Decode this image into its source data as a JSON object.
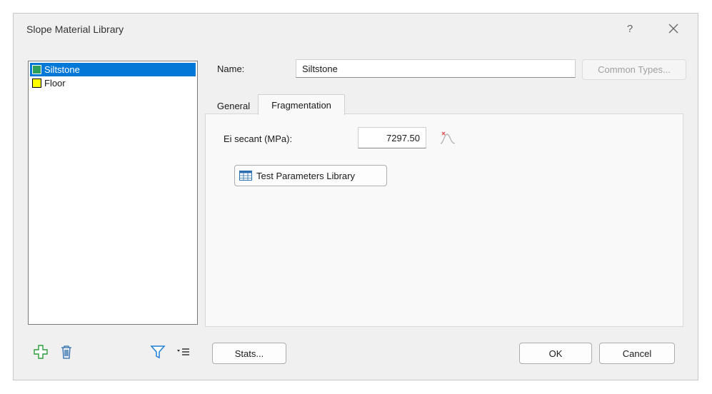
{
  "window": {
    "title": "Slope Material Library",
    "help_glyph": "?"
  },
  "materials": [
    {
      "name": "Siltstone",
      "color": "#2e9e5b",
      "selected": true
    },
    {
      "name": "Floor",
      "color": "#ffff00",
      "selected": false
    }
  ],
  "name_field": {
    "label": "Name:",
    "value": "Siltstone"
  },
  "common_types_label": "Common Types...",
  "tabs": [
    {
      "label": "General",
      "active": false
    },
    {
      "label": "Fragmentation",
      "active": true
    }
  ],
  "fragmentation": {
    "ei_label": "Ei secant (MPa):",
    "ei_value": "7297.50",
    "test_params_label": "Test Parameters Library"
  },
  "buttons": {
    "stats": "Stats...",
    "ok": "OK",
    "cancel": "Cancel"
  },
  "colors": {
    "accent": "#0078d7",
    "add_icon": "#2e9e3a",
    "filter_icon": "#1f7fd6"
  }
}
